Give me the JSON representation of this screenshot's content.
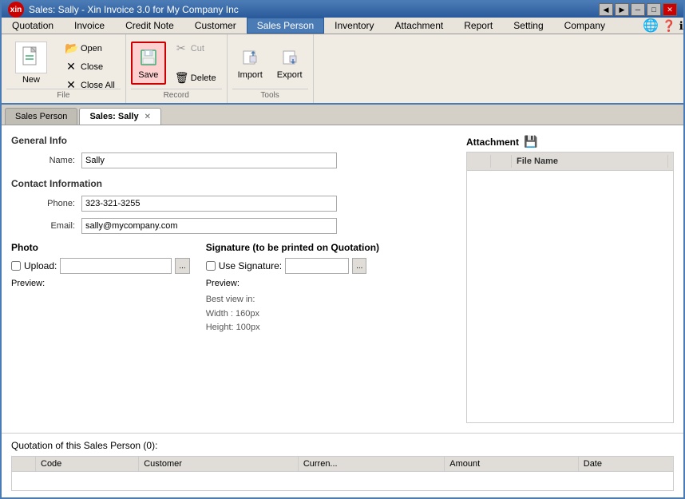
{
  "window": {
    "title": "Sales: Sally - Xin Invoice 3.0 for My Company Inc",
    "logo": "xin"
  },
  "title_nav": {
    "back_label": "◀",
    "forward_label": "▶"
  },
  "menu": {
    "items": [
      {
        "id": "quotation",
        "label": "Quotation"
      },
      {
        "id": "invoice",
        "label": "Invoice"
      },
      {
        "id": "credit_note",
        "label": "Credit Note"
      },
      {
        "id": "customer",
        "label": "Customer"
      },
      {
        "id": "sales_person",
        "label": "Sales Person",
        "active": true
      },
      {
        "id": "inventory",
        "label": "Inventory"
      },
      {
        "id": "attachment",
        "label": "Attachment"
      },
      {
        "id": "report",
        "label": "Report"
      },
      {
        "id": "setting",
        "label": "Setting"
      },
      {
        "id": "company",
        "label": "Company"
      }
    ]
  },
  "ribbon": {
    "file_group": {
      "label": "File",
      "new_label": "New",
      "new_icon": "📄",
      "open_label": "Open",
      "close_label": "Close",
      "close_all_label": "Close All"
    },
    "record_group": {
      "label": "Record",
      "save_label": "Save",
      "cut_label": "Cut",
      "delete_label": "Delete"
    },
    "tools_group": {
      "label": "Tools",
      "import_label": "Import",
      "export_label": "Export"
    }
  },
  "tabs": [
    {
      "id": "sales_person_tab",
      "label": "Sales Person",
      "closable": false
    },
    {
      "id": "sally_tab",
      "label": "Sales: Sally",
      "closable": true,
      "active": true
    }
  ],
  "form": {
    "general_info_label": "General Info",
    "name_label": "Name:",
    "name_value": "Sally",
    "contact_info_label": "Contact Information",
    "phone_label": "Phone:",
    "phone_value": "323-321-3255",
    "email_label": "Email:",
    "email_value": "sally@mycompany.com"
  },
  "photo": {
    "section_label": "Photo",
    "upload_label": "Upload:",
    "preview_label": "Preview:"
  },
  "signature": {
    "section_label": "Signature (to be printed on Quotation)",
    "use_signature_label": "Use Signature:",
    "preview_label": "Preview:",
    "hint_line1": "Best view in:",
    "hint_line2": "Width : 160px",
    "hint_line3": "Height: 100px"
  },
  "attachment": {
    "label": "Attachment",
    "columns": [
      "",
      "",
      "File Name"
    ]
  },
  "quotation": {
    "title": "Quotation of this Sales Person (0):",
    "columns": [
      "Code",
      "Customer",
      "Curren...",
      "Amount",
      "Date"
    ]
  },
  "toolbar_controls": {
    "globe_icon": "🌐",
    "help_icon": "❓",
    "info_icon": "ℹ"
  }
}
